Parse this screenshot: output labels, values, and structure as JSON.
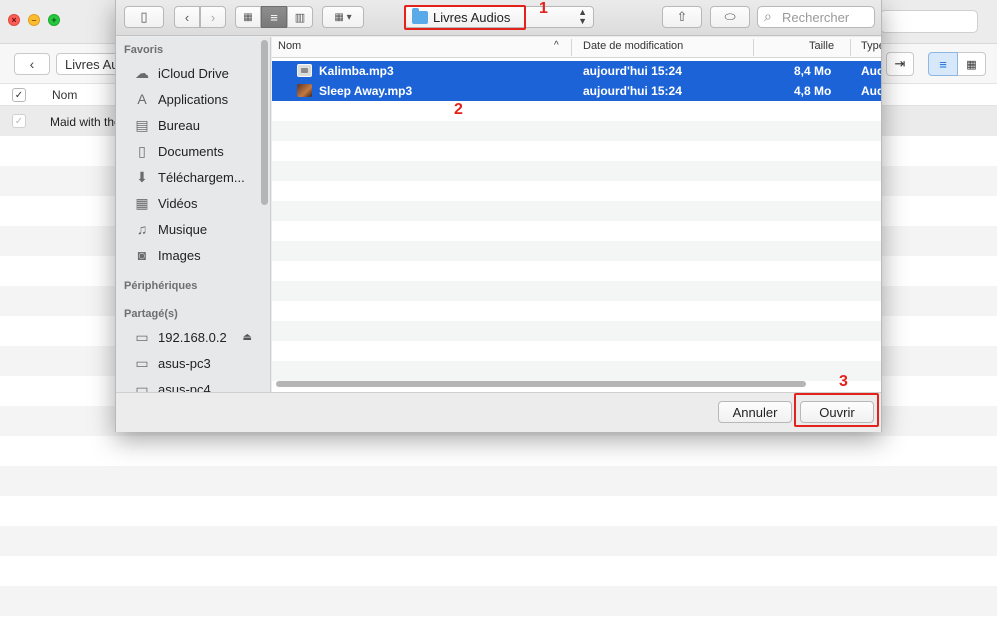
{
  "background_app": {
    "breadcrumb": "Livres Audios",
    "header_nom": "Nom",
    "first_row": "Maid with the"
  },
  "dialog": {
    "path_label": "Livres Audios",
    "search_placeholder": "Rechercher",
    "sidebar": {
      "favoris_title": "Favoris",
      "favoris": [
        {
          "label": "iCloud Drive",
          "icon": "cloud-icon"
        },
        {
          "label": "Applications",
          "icon": "applications-icon"
        },
        {
          "label": "Bureau",
          "icon": "desktop-icon"
        },
        {
          "label": "Documents",
          "icon": "document-icon"
        },
        {
          "label": "Téléchargem...",
          "icon": "download-icon"
        },
        {
          "label": "Vidéos",
          "icon": "film-icon"
        },
        {
          "label": "Musique",
          "icon": "music-icon"
        },
        {
          "label": "Images",
          "icon": "camera-icon"
        }
      ],
      "peripheriques_title": "Périphériques",
      "partages_title": "Partagé(s)",
      "partages": [
        {
          "label": "192.168.0.2",
          "icon": "computer-icon"
        },
        {
          "label": "asus-pc3",
          "icon": "computer-icon"
        },
        {
          "label": "asus-pc4",
          "icon": "computer-icon"
        }
      ]
    },
    "columns": {
      "nom": "Nom",
      "date": "Date de modification",
      "taille": "Taille",
      "type": "Type"
    },
    "files": [
      {
        "name": "Kalimba.mp3",
        "date": "aujourd'hui 15:24",
        "size": "8,4 Mo",
        "type": "Audio"
      },
      {
        "name": "Sleep Away.mp3",
        "date": "aujourd'hui 15:24",
        "size": "4,8 Mo",
        "type": "Audio"
      }
    ],
    "cancel_label": "Annuler",
    "open_label": "Ouvrir"
  },
  "annotations": [
    "1",
    "2",
    "3"
  ],
  "colors": {
    "selection": "#1c63d8",
    "annotation": "#e3231b",
    "folder": "#5aa9e8"
  }
}
